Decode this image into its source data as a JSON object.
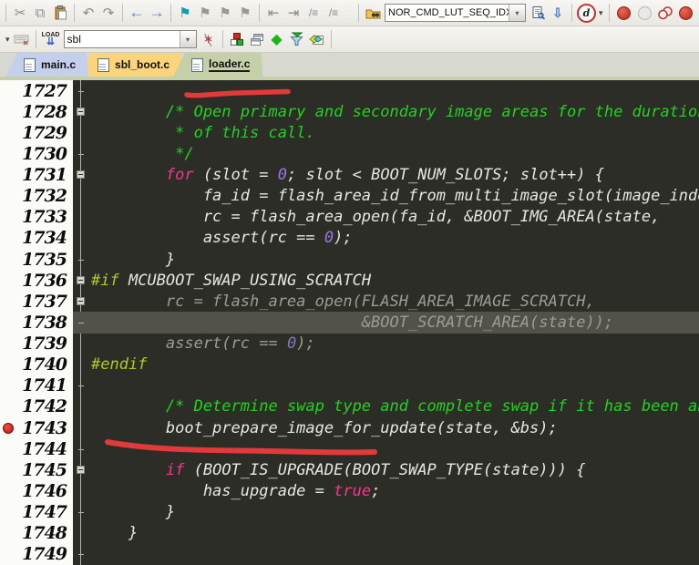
{
  "colors": {
    "editor_background": "#2d2d27",
    "comment": "#21d121",
    "keyword": "#f5368f",
    "number": "#9b78e0",
    "plain_text": "#e8e8e0",
    "preprocessor": "#aacc22",
    "inactive_code": "#9c9c94",
    "highlight_line": "#53524a",
    "annotation_red": "#e23a3a",
    "breakpoint_red": "#c01010",
    "tab_main": "#c4cfec",
    "tab_sbl_boot": "#fbd47c",
    "tab_loader": "#c6d0a8"
  },
  "icons": {
    "cut": "✂",
    "copy": "⧉",
    "paste": "svg-clipboard",
    "undo": "↶",
    "redo": "↷",
    "nav-back": "←",
    "nav-forward": "→",
    "bookmark": "⚑",
    "bookmark-prev": "⚑",
    "bookmark-next": "⚑",
    "bookmark-clear": "⚑",
    "bookmark-prev-sub": "◂",
    "bookmark-next-sub": "▸",
    "bookmark-clear-sub": "x",
    "indent-decrease": "⇤",
    "indent-increase": "⇥",
    "comment-lines": "/≡",
    "uncomment-lines": "/≡",
    "open-search": "svg-folder-binoculars",
    "find-in-doc": "svg-doc-search",
    "search-down": "⇩",
    "quick-search": "d",
    "dropdown-caret": "▾",
    "breakpoint-toggle": "red-circle",
    "breakpoint-enable": "gray-circle",
    "breakpoint-disable": "svg-double-circle",
    "breakpoint-edge": "red-circle",
    "target-caret": "▾",
    "keyboard": "svg-keyboard",
    "load-label": "LOAD",
    "load-arrows": "⇊",
    "wand": "✶",
    "build-cubes": "svg-cubes",
    "cascade-windows": "svg-cascade",
    "diamond": "◆",
    "filter-funnel": "svg-funnel",
    "envelope-diamonds": "svg-envelope"
  },
  "toolbar": {
    "search_combo_value": "NOR_CMD_LUT_SEQ_IDX_",
    "target_combo_value": "sbl"
  },
  "tabs": [
    {
      "label": "main.c",
      "active": false
    },
    {
      "label": "sbl_boot.c",
      "active": false
    },
    {
      "label": "loader.c",
      "active": true
    }
  ],
  "editor": {
    "breakpoint_line": "1743",
    "lines": [
      {
        "n": "1727",
        "f": "tick",
        "s": []
      },
      {
        "n": "1728",
        "f": "box",
        "s": [
          [
            "cm",
            "        /* Open primary and secondary image areas for the duration"
          ]
        ]
      },
      {
        "n": "1729",
        "f": "",
        "s": [
          [
            "cm",
            "         * of this call."
          ]
        ]
      },
      {
        "n": "1730",
        "f": "tick",
        "s": [
          [
            "cm",
            "         */"
          ]
        ]
      },
      {
        "n": "1731",
        "f": "box",
        "s": [
          [
            "pl",
            "        "
          ],
          [
            "kw",
            "for"
          ],
          [
            "pl",
            " (slot = "
          ],
          [
            "nu",
            "0"
          ],
          [
            "pl",
            "; slot < BOOT_NUM_SLOTS; slot++) {"
          ]
        ]
      },
      {
        "n": "1732",
        "f": "",
        "s": [
          [
            "pl",
            "            fa_id = flash_area_id_from_multi_image_slot(image_index"
          ]
        ]
      },
      {
        "n": "1733",
        "f": "",
        "s": [
          [
            "pl",
            "            rc = flash_area_open(fa_id, &BOOT_IMG_AREA(state,"
          ]
        ]
      },
      {
        "n": "1734",
        "f": "",
        "s": [
          [
            "pl",
            "            assert(rc == "
          ],
          [
            "nu",
            "0"
          ],
          [
            "pl",
            ");"
          ]
        ]
      },
      {
        "n": "1735",
        "f": "tick",
        "s": [
          [
            "pl",
            "        }"
          ]
        ]
      },
      {
        "n": "1736",
        "f": "box",
        "s": [
          [
            "pp",
            "#if"
          ],
          [
            "pl",
            " MCUBOOT_SWAP_USING_SCRATCH"
          ]
        ]
      },
      {
        "n": "1737",
        "f": "box",
        "s": [
          [
            "gy",
            "        rc = flash_area_open(FLASH_AREA_IMAGE_SCRATCH,"
          ]
        ]
      },
      {
        "n": "1738",
        "f": "tick",
        "hl": true,
        "s": [
          [
            "gy",
            "                             &BOOT_SCRATCH_AREA(state));"
          ]
        ]
      },
      {
        "n": "1739",
        "f": "",
        "s": [
          [
            "gy",
            "        assert(rc == "
          ],
          [
            "gn",
            "0"
          ],
          [
            "gy",
            ");"
          ]
        ]
      },
      {
        "n": "1740",
        "f": "",
        "s": [
          [
            "pp",
            "#endif"
          ]
        ]
      },
      {
        "n": "1741",
        "f": "tick",
        "s": []
      },
      {
        "n": "1742",
        "f": "",
        "s": [
          [
            "cm",
            "        /* Determine swap type and complete swap if it has been abor"
          ]
        ]
      },
      {
        "n": "1743",
        "f": "",
        "bp": true,
        "s": [
          [
            "pl",
            "        boot_prepare_image_for_update(state, &bs);"
          ]
        ]
      },
      {
        "n": "1744",
        "f": "tick",
        "s": []
      },
      {
        "n": "1745",
        "f": "box",
        "s": [
          [
            "pl",
            "        "
          ],
          [
            "kw",
            "if"
          ],
          [
            "pl",
            " (BOOT_IS_UPGRADE(BOOT_SWAP_TYPE(state))) {"
          ]
        ]
      },
      {
        "n": "1746",
        "f": "",
        "s": [
          [
            "pl",
            "            has_upgrade = "
          ],
          [
            "kw",
            "true"
          ],
          [
            "pl",
            ";"
          ]
        ]
      },
      {
        "n": "1747",
        "f": "tick",
        "s": [
          [
            "pl",
            "        }"
          ]
        ]
      },
      {
        "n": "1748",
        "f": "",
        "s": [
          [
            "pl",
            "    }"
          ]
        ]
      },
      {
        "n": "1749",
        "f": "tick",
        "s": []
      }
    ]
  }
}
